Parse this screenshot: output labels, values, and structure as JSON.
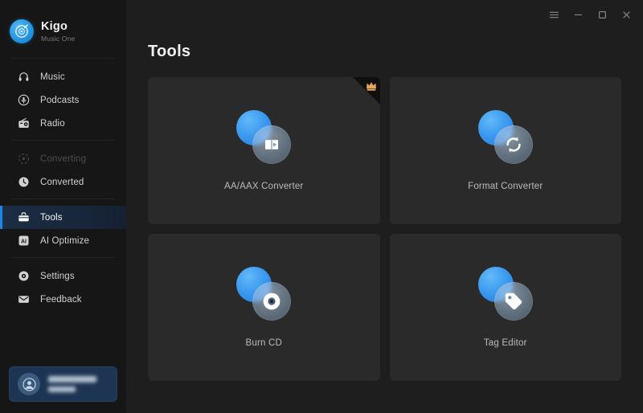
{
  "app": {
    "brand_name": "Kigo",
    "brand_subtitle": "Music One"
  },
  "titlebar": {
    "menu_label": "menu-icon",
    "minimize_label": "minimize-icon",
    "maximize_label": "maximize-icon",
    "close_label": "close-icon"
  },
  "sidebar": {
    "groups": [
      {
        "items": [
          {
            "label": "Music",
            "icon": "headphones-icon",
            "state": "normal"
          },
          {
            "label": "Podcasts",
            "icon": "podcast-icon",
            "state": "normal"
          },
          {
            "label": "Radio",
            "icon": "radio-icon",
            "state": "normal"
          }
        ]
      },
      {
        "items": [
          {
            "label": "Converting",
            "icon": "converting-icon",
            "state": "disabled"
          },
          {
            "label": "Converted",
            "icon": "clock-icon",
            "state": "normal"
          }
        ]
      },
      {
        "items": [
          {
            "label": "Tools",
            "icon": "toolbox-icon",
            "state": "active"
          },
          {
            "label": "AI Optimize",
            "icon": "ai-icon",
            "state": "normal"
          }
        ]
      },
      {
        "items": [
          {
            "label": "Settings",
            "icon": "gear-icon",
            "state": "normal"
          },
          {
            "label": "Feedback",
            "icon": "envelope-icon",
            "state": "normal"
          }
        ]
      }
    ],
    "user": {
      "name_redacted": true,
      "plan_redacted": true
    }
  },
  "main": {
    "page_title": "Tools",
    "cards": [
      {
        "label": "AA/AAX Converter",
        "icon": "audiobook-play-icon",
        "badge": "premium-crown-icon"
      },
      {
        "label": "Format Converter",
        "icon": "refresh-arrows-icon",
        "badge": null
      },
      {
        "label": "Burn CD",
        "icon": "disc-icon",
        "badge": null
      },
      {
        "label": "Tag Editor",
        "icon": "price-tag-icon",
        "badge": null
      }
    ]
  },
  "colors": {
    "accent": "#1f84e8",
    "sidebar_bg": "#161616",
    "main_bg": "#1e1e1e",
    "card_bg": "#2a2a2a",
    "active_bg": "#1b2e44",
    "badge": "#e8a65c"
  }
}
